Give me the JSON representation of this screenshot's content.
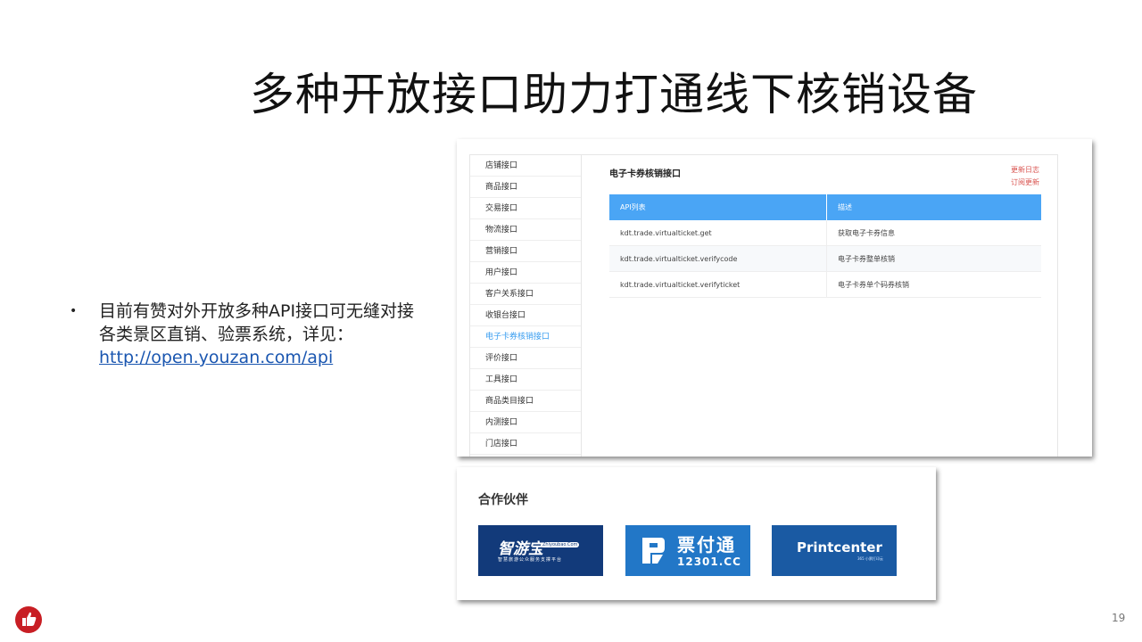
{
  "slide": {
    "title": "多种开放接口助力打通线下核销设备",
    "page_number": "19"
  },
  "bullet": {
    "marker": "•",
    "text": "目前有赞对外开放多种API接口可无缝对接各类景区直销、验票系统，详见：",
    "link": "http://open.youzan.com/api"
  },
  "api_screenshot": {
    "sidebar_items": [
      {
        "label": "店铺接口"
      },
      {
        "label": "商品接口"
      },
      {
        "label": "交易接口"
      },
      {
        "label": "物流接口"
      },
      {
        "label": "营销接口"
      },
      {
        "label": "用户接口"
      },
      {
        "label": "客户关系接口"
      },
      {
        "label": "收银台接口"
      },
      {
        "label": "电子卡券核销接口",
        "active": true
      },
      {
        "label": "评价接口"
      },
      {
        "label": "工具接口"
      },
      {
        "label": "商品类目接口"
      },
      {
        "label": "内测接口"
      },
      {
        "label": "门店接口"
      }
    ],
    "heading": "电子卡券核销接口",
    "links": [
      "更新日志",
      "订阅更新"
    ],
    "table": {
      "headers": [
        "API列表",
        "描述"
      ],
      "rows": [
        [
          "kdt.trade.virtualticket.get",
          "获取电子卡券信息"
        ],
        [
          "kdt.trade.virtualticket.verifycode",
          "电子卡券整单核销"
        ],
        [
          "kdt.trade.virtualticket.verifyticket",
          "电子卡券单个码券核销"
        ]
      ]
    },
    "colors": {
      "table_header": "#4aa5f5",
      "active_nav": "#3b9ef0",
      "link": "#d9534f"
    }
  },
  "partners": {
    "title": "合作伙伴",
    "logos": [
      {
        "name": "智游宝",
        "site": "Zhiyoubao.Com",
        "sub": "智慧旅游公众服务支撑平台",
        "color": "#123a7a"
      },
      {
        "name": "票付通",
        "url": "12301.CC",
        "color": "#2277c7"
      },
      {
        "name": "Printcenter",
        "tag": "365 小票打印云",
        "color": "#1a5aa3"
      }
    ]
  }
}
